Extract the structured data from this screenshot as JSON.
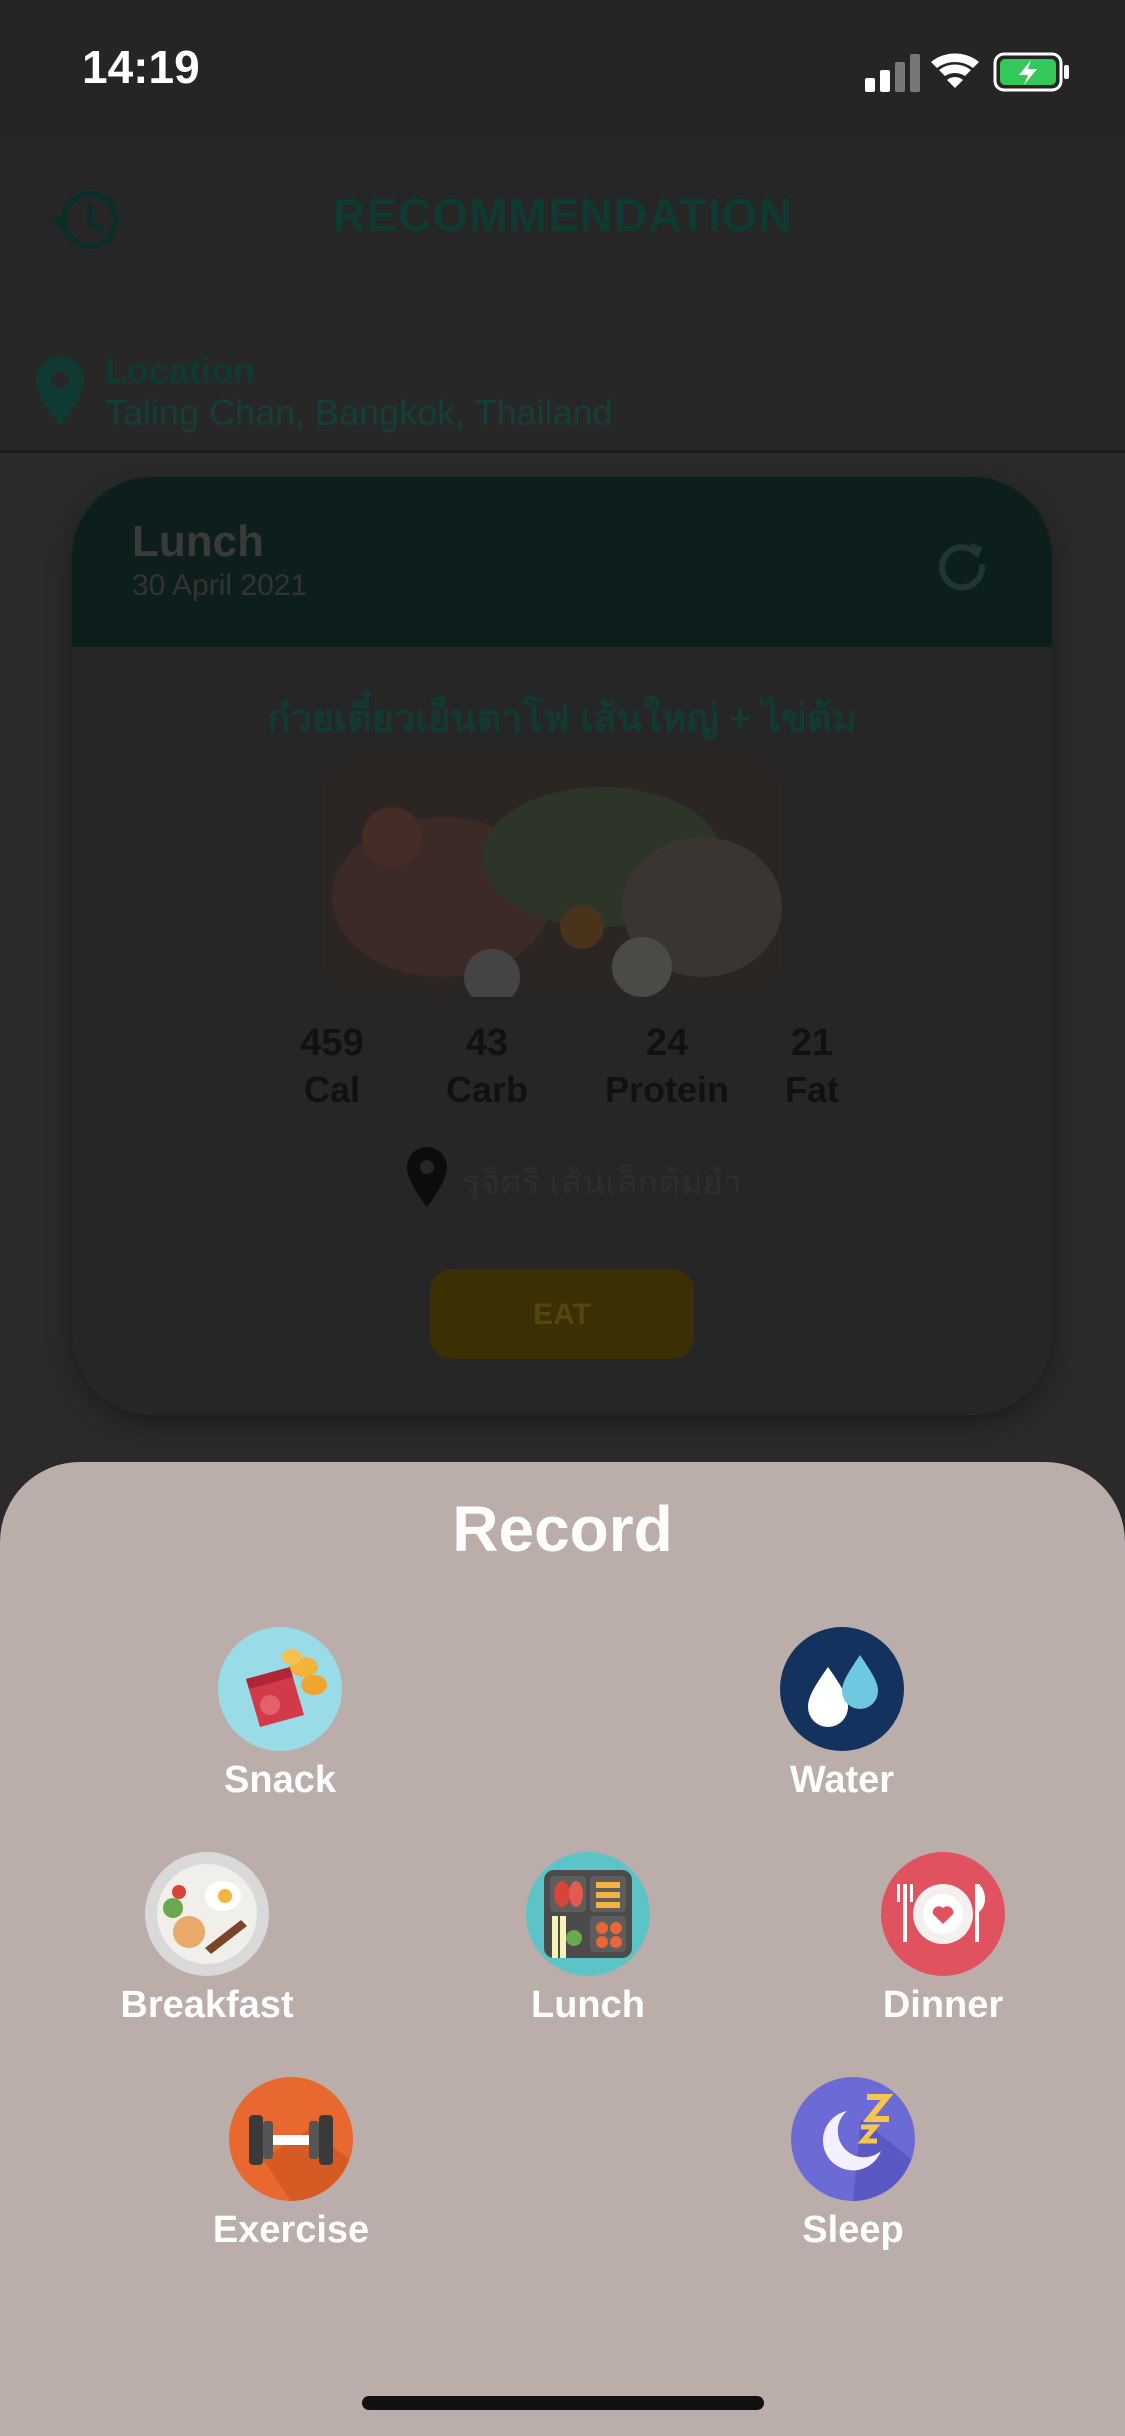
{
  "status_bar": {
    "time": "14:19"
  },
  "header": {
    "title": "RECOMMENDATION",
    "history_icon": "history-icon"
  },
  "location": {
    "label": "Location",
    "value": "Taling Chan, Bangkok, Thailand"
  },
  "recommendation_card": {
    "meal": "Lunch",
    "date": "30 April 2021",
    "dish": "ก๋วยเตี๋ยวเย็นตาโฟ เส้นใหญ่ + ไข่ต้ม",
    "nutrients": [
      {
        "value": "459",
        "label": "Cal"
      },
      {
        "value": "43",
        "label": "Carb"
      },
      {
        "value": "24",
        "label": "Protein"
      },
      {
        "value": "21",
        "label": "Fat"
      }
    ],
    "shop": "รุจิศรี เส้นเล็กต้มยำ",
    "eat_label": "EAT"
  },
  "record_sheet": {
    "title": "Record",
    "items": [
      {
        "label": "Snack",
        "icon": "snack-icon"
      },
      {
        "label": "Water",
        "icon": "water-icon"
      },
      {
        "label": "Breakfast",
        "icon": "breakfast-icon"
      },
      {
        "label": "Lunch",
        "icon": "lunch-icon"
      },
      {
        "label": "Dinner",
        "icon": "dinner-icon"
      },
      {
        "label": "Exercise",
        "icon": "exercise-icon"
      },
      {
        "label": "Sleep",
        "icon": "sleep-icon"
      }
    ]
  },
  "colors": {
    "accent_green": "#0e3a33",
    "sheet_bg": "#bbadaa",
    "eat_button": "#3b3003"
  }
}
